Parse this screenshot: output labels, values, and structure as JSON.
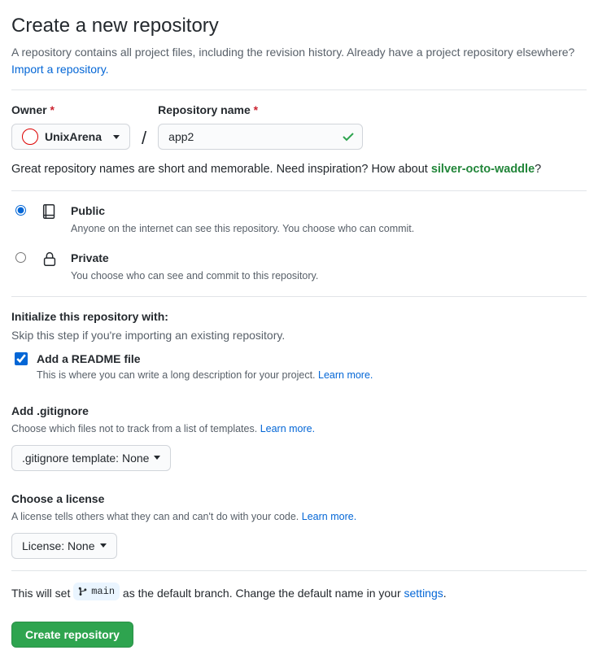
{
  "header": {
    "title": "Create a new repository",
    "subtitle": "A repository contains all project files, including the revision history. Already have a project repository elsewhere?",
    "import_link": "Import a repository."
  },
  "owner": {
    "label": "Owner",
    "value": "UnixArena"
  },
  "repo": {
    "label": "Repository name",
    "value": "app2"
  },
  "hint": {
    "pre": "Great repository names are short and memorable. Need inspiration? How about ",
    "suggestion": "silver-octo-waddle",
    "post": "?"
  },
  "visibility": {
    "public": {
      "title": "Public",
      "desc": "Anyone on the internet can see this repository. You choose who can commit.",
      "selected": true
    },
    "private": {
      "title": "Private",
      "desc": "You choose who can see and commit to this repository.",
      "selected": false
    }
  },
  "init": {
    "heading": "Initialize this repository with:",
    "skip": "Skip this step if you're importing an existing repository."
  },
  "readme": {
    "label": "Add a README file",
    "desc": "This is where you can write a long description for your project. ",
    "learn": "Learn more.",
    "checked": true
  },
  "gitignore": {
    "heading": "Add .gitignore",
    "desc": "Choose which files not to track from a list of templates. ",
    "learn": "Learn more.",
    "button": ".gitignore template: None"
  },
  "license": {
    "heading": "Choose a license",
    "desc": "A license tells others what they can and can't do with your code. ",
    "learn": "Learn more.",
    "button": "License: None"
  },
  "branch": {
    "pre": "This will set ",
    "name": "main",
    "mid": " as the default branch. Change the default name in your ",
    "settings": "settings",
    "post": "."
  },
  "submit": "Create repository"
}
